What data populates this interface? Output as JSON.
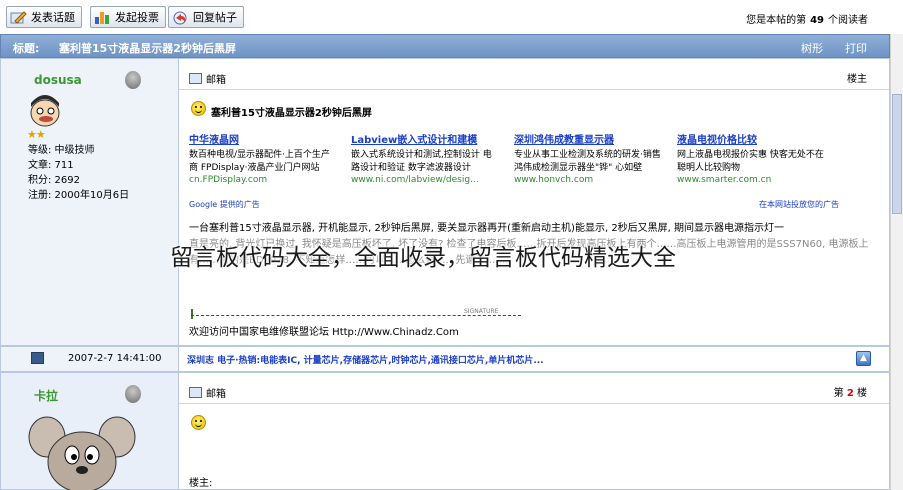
{
  "toolbar": {
    "new_topic": "发表话题",
    "new_poll": "发起投票",
    "reply": "回复帖子",
    "reader_prefix": "您是本帖的第",
    "reader_count": "49",
    "reader_suffix": "个阅读者"
  },
  "titlebar": {
    "label": "标题:",
    "title": "塞利普15寸液晶显示器2秒钟后黑屏",
    "tree_view": "树形",
    "print": "打印"
  },
  "post1": {
    "username": "dosusa",
    "stars": "★★",
    "info": [
      "等级: 中级技师",
      "文章: 711",
      "积分: 2692",
      "注册: 2000年10月6日"
    ],
    "mail_label": "邮箱",
    "floor_label": "楼主",
    "post_title": "塞利普15寸液晶显示器2秒钟后黑屏",
    "ads": [
      {
        "heading": "中华液晶网",
        "desc": "数百种电视/显示器配件·上百个生产商 FPDisplay·液晶产业门户网站",
        "url": "cn.FPDisplay.com"
      },
      {
        "heading": "Labview嵌入式设计和建模",
        "desc": "嵌入式系统设计和测试,控制设计 电路设计和验证 数字滤波器设计",
        "url": "www.ni.com/labview/desig..."
      },
      {
        "heading": "深圳鸿伟成教重显示器",
        "desc": "专业从事工业检测及系统的研发·销售 鸿伟成检测显示器坐\"铧\" 心如壁",
        "url": "www.honvch.com"
      },
      {
        "heading": "液晶电视价格比较",
        "desc": "网上液晶电视报价实惠 快客无处不在 聪明人比较购物",
        "url": "www.smarter.com.cn"
      }
    ],
    "ad_footer_left": "Google 提供的广告",
    "ad_footer_right": "在本网站投放您的广告",
    "body_line1": "一台塞利普15寸液晶显示器, 开机能显示, 2秒钟后黑屏, 要关显示器再开(重新启动主机)能显示, 2秒后又黑屏, 期间显示器电源指示灯一",
    "body_line2_faint": "直是亮的, 背光灯已换过, 我怀疑是高压板坏了, 坏了没有? 检查了电容后板……拆开后发现高压板上有两个……高压板上电源管用的是SSS7N60, 电源板上",
    "body_line3_faint": "有……用的是BD9978, 不知道怎样……可以……怎么修……先谢了……。",
    "sig_word": "SIGNATURE",
    "sig_text": "欢迎访问中国家电维修联盟论坛 Http://Www.Chinadz.Com"
  },
  "post_meta": {
    "time": "2007-2-7 14:41:00",
    "ad_links": "深圳志 电子·热销:电能表IC, 计量芯片,存储器芯片,时钟芯片,通讯接口芯片,单片机芯片..."
  },
  "post2": {
    "username": "卡拉",
    "mail_label": "邮箱",
    "floor_prefix": "第",
    "floor_number": "2",
    "floor_suffix": "楼",
    "body": "楼主:"
  },
  "overlay": {
    "watermark": "留言板代码大全，全面收录，留言板代码精选大全"
  },
  "colors": {
    "titlebar": "#7a9bcc",
    "username": "#3a9a32",
    "link": "#1a3ec8",
    "ad_url": "#2f8a2f"
  }
}
